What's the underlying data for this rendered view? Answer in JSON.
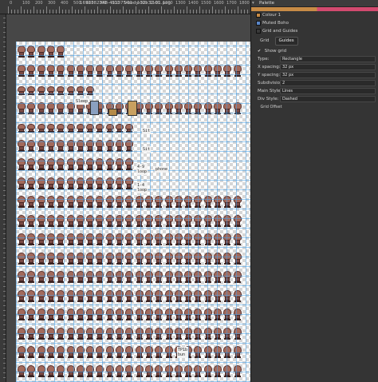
{
  "document": {
    "title": "1691382348-411375-body-32x32-01.png",
    "close_glyph": "×"
  },
  "ruler": {
    "labels": [
      "0",
      "100",
      "200",
      "300",
      "400",
      "500",
      "600",
      "700",
      "800",
      "900",
      "1000",
      "1100",
      "1200",
      "1300",
      "1400",
      "1500",
      "1600",
      "1700",
      "1800"
    ]
  },
  "canvas": {
    "labels": {
      "sleep": "Sleep",
      "sit1": "Sit",
      "sit2": "Sit",
      "loop": "4-9\nloop",
      "phone": "phone",
      "loop2": "1-4\nloop",
      "bun": "TP1b\nbun"
    }
  },
  "panel": {
    "palette_title": "Palette",
    "colour_label": "Colour 1",
    "palette_name": "Muted Boho",
    "grid_title": "Grid and Guides",
    "tabs": [
      "Grid",
      "Guides"
    ],
    "active_tab": "Guides",
    "show_grid_label": "Show grid",
    "show_grid_checked": true,
    "rows": [
      {
        "label": "Type:",
        "value": "Rectangle"
      },
      {
        "label": "X spacing:",
        "value": "32 px"
      },
      {
        "label": "Y spacing:",
        "value": "32 px"
      },
      {
        "label": "Subdivision:",
        "value": "2"
      },
      {
        "label": "Main Style:",
        "value": "Lines"
      },
      {
        "label": "Div Style:",
        "value": "Dashed"
      }
    ],
    "grid_offset_label": "Grid Offset",
    "colors": {
      "swatch_colour1": "#c78b46",
      "swatch_muted": "#5a86c8",
      "swatch_grid": "#3a3a3a"
    }
  }
}
